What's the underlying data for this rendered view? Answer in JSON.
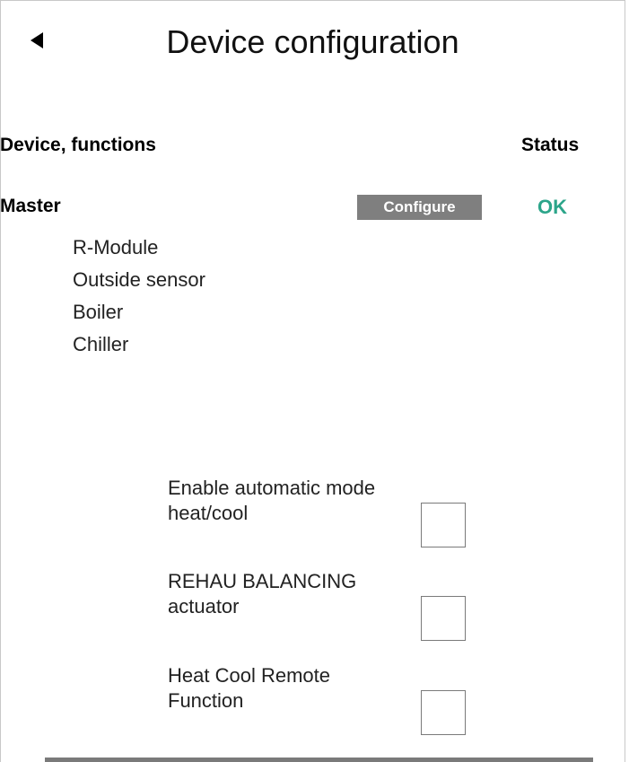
{
  "header": {
    "title": "Device configuration",
    "back_icon": "back-triangle-icon"
  },
  "table": {
    "col_device": "Device, functions",
    "col_status": "Status"
  },
  "device": {
    "name": "Master",
    "configure_label": "Configure",
    "status": "OK",
    "status_color": "#2ca58a",
    "functions": [
      "R-Module",
      "Outside sensor",
      "Boiler",
      "Chiller"
    ]
  },
  "options": [
    {
      "line1": "Enable automatic mode",
      "line2": "heat/cool",
      "checked": false
    },
    {
      "line1": "REHAU BALANCING",
      "line2": "actuator",
      "checked": false
    },
    {
      "line1": "Heat Cool Remote",
      "line2": "Function",
      "checked": false
    }
  ],
  "colors": {
    "button_bg": "#7f7f7f",
    "status_ok": "#2ca58a"
  }
}
